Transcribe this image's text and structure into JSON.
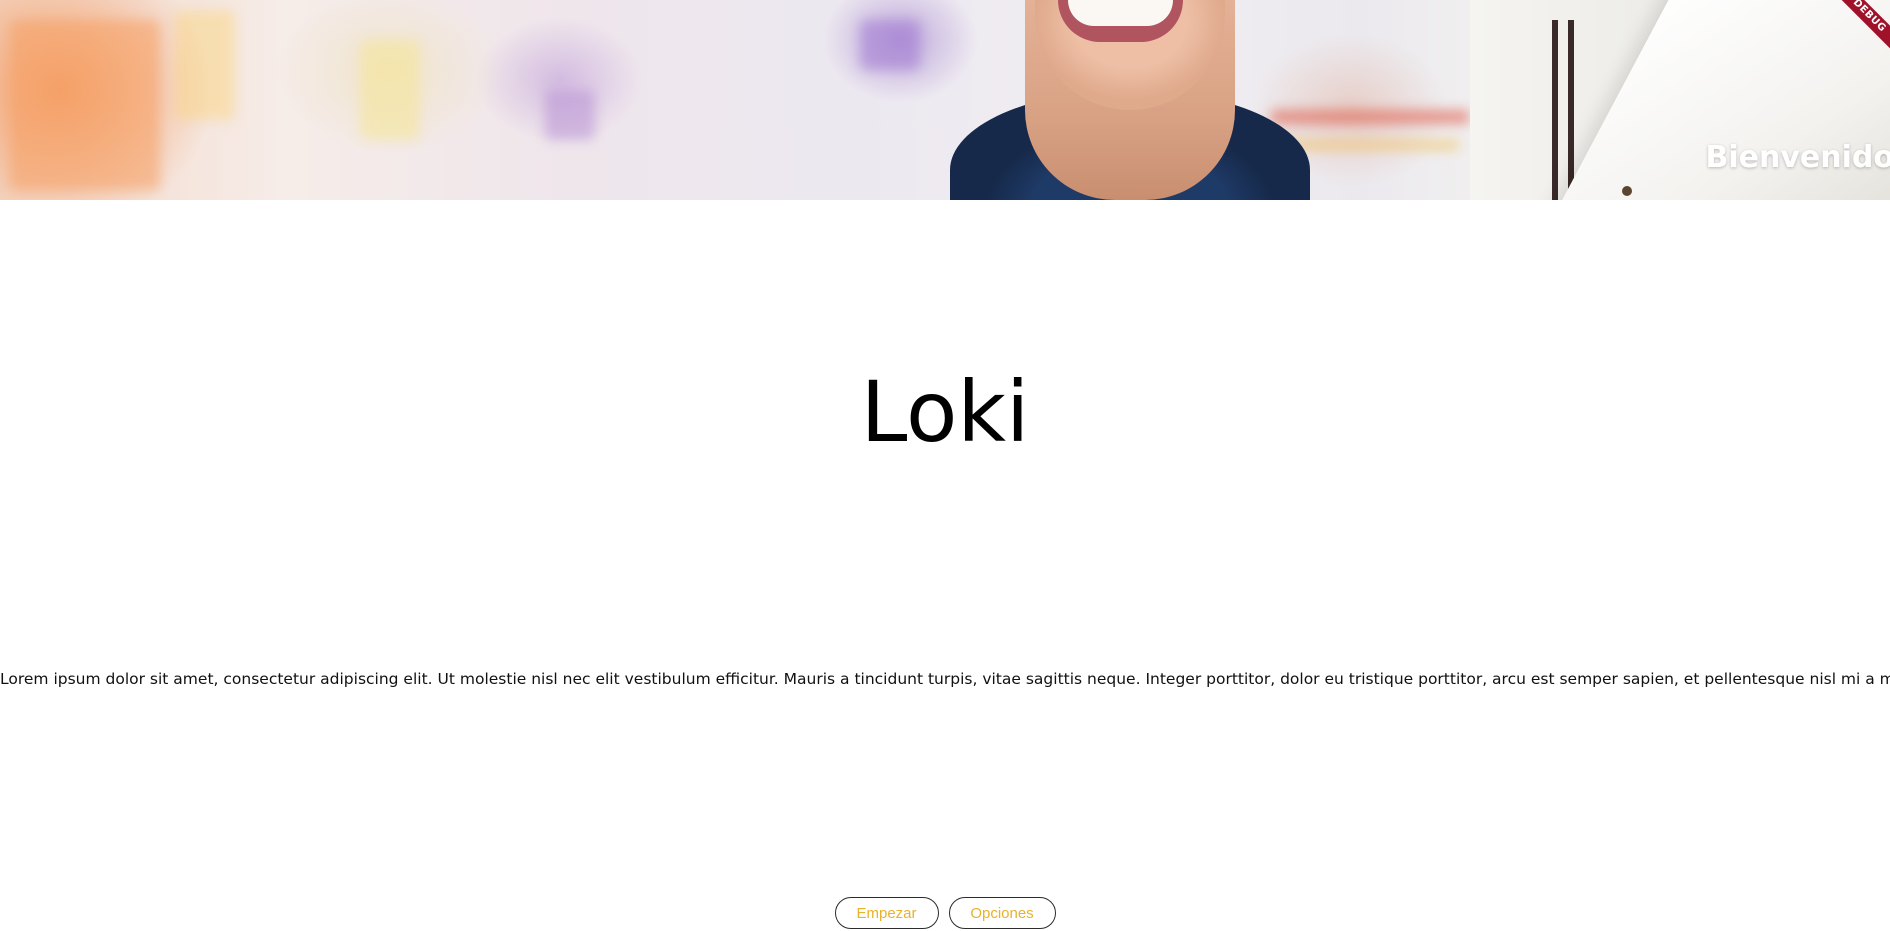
{
  "hero": {
    "title": "Bienvenido"
  },
  "debug_banner": {
    "label": "DEBUG",
    "color": "#a0122a"
  },
  "main": {
    "title": "Loki",
    "description": "Lorem ipsum dolor sit amet, consectetur adipiscing elit. Ut molestie nisl nec elit vestibulum efficitur. Mauris a tincidunt turpis, vitae sagittis neque. Integer porttitor, dolor eu tristique porttitor, arcu est semper sapien, et pellentesque nisl mi a magna."
  },
  "actions": {
    "start_label": "Empezar",
    "options_label": "Opciones",
    "button_text_color": "#e8b22a",
    "button_border_color": "#2b2b2b"
  }
}
